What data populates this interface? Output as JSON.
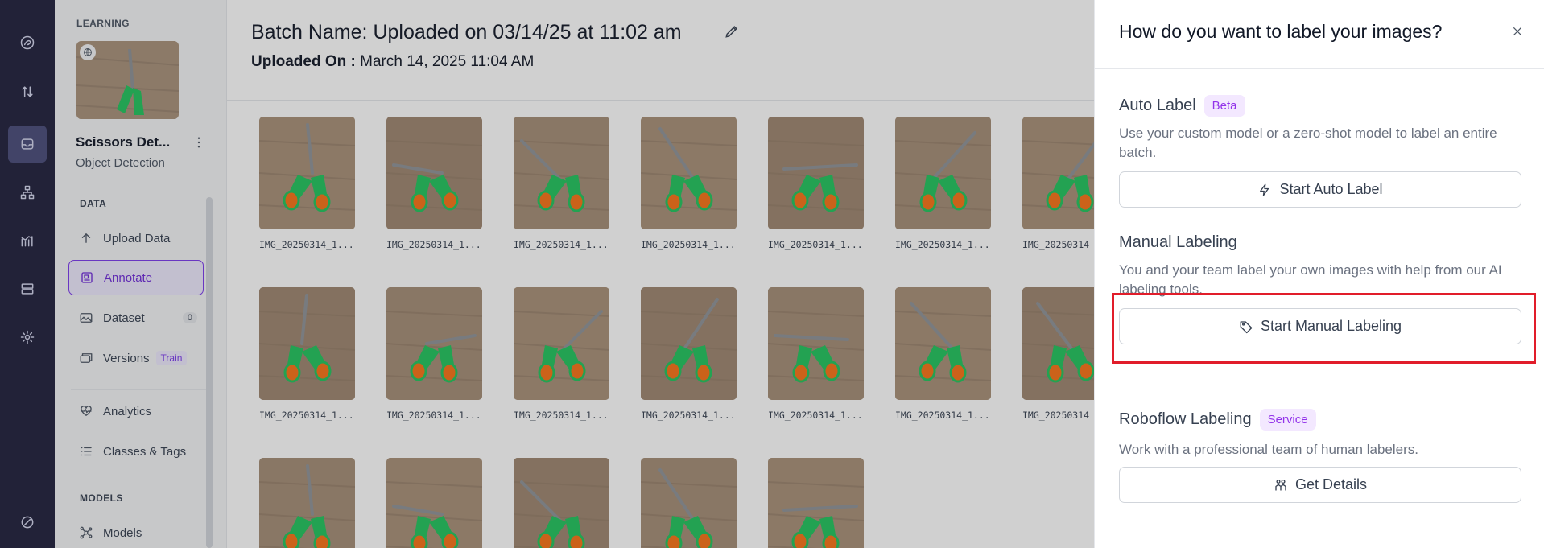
{
  "rail": {
    "items": [
      "logo",
      "transfer",
      "inbox",
      "workflow",
      "analytics",
      "deployments",
      "settings",
      "support"
    ]
  },
  "sidebar": {
    "section_label": "LEARNING",
    "project_name": "Scissors Det...",
    "project_type": "Object Detection",
    "data_heading": "DATA",
    "models_heading": "MODELS",
    "items": [
      {
        "label": "Upload Data",
        "icon": "upload-arrow-icon"
      },
      {
        "label": "Annotate",
        "icon": "annotate-icon",
        "active": true
      },
      {
        "label": "Dataset",
        "icon": "image-icon",
        "count": "0"
      },
      {
        "label": "Versions",
        "icon": "versions-icon",
        "badge": "Train"
      },
      {
        "label": "Analytics",
        "icon": "heart-pulse-icon"
      },
      {
        "label": "Classes & Tags",
        "icon": "list-icon"
      },
      {
        "label": "Models",
        "icon": "model-graph-icon"
      }
    ]
  },
  "main": {
    "batch_label": "Batch Name:",
    "batch_name": "Uploaded on 03/14/25 at 11:02 am",
    "uploaded_label": "Uploaded On",
    "uploaded_sep": ":",
    "uploaded_value": "March 14, 2025 11:04 AM",
    "images": [
      "IMG_20250314_1...",
      "IMG_20250314_1...",
      "IMG_20250314_1...",
      "IMG_20250314_1...",
      "IMG_20250314_1...",
      "IMG_20250314_1...",
      "IMG_20250314",
      "IMG_20250314_1...",
      "IMG_20250314_1...",
      "IMG_20250314_1...",
      "IMG_20250314_1...",
      "IMG_20250314_1...",
      "IMG_20250314_1...",
      "IMG_20250314",
      "",
      "",
      "",
      "",
      ""
    ]
  },
  "drawer": {
    "title": "How do you want to label your images?",
    "auto": {
      "heading": "Auto Label",
      "tag": "Beta",
      "desc": "Use your custom model or a zero-shot model to label an entire batch.",
      "button": "Start Auto Label"
    },
    "manual": {
      "heading": "Manual Labeling",
      "desc": "You and your team label your own images with help from our AI labeling tools.",
      "button": "Start Manual Labeling"
    },
    "service": {
      "heading": "Roboflow Labeling",
      "tag": "Service",
      "desc": "Work with a professional team of human labelers.",
      "button": "Get Details"
    }
  },
  "colors": {
    "accent": "#7c3aed",
    "rail_bg": "#20203d",
    "highlight": "#e11d2a"
  }
}
